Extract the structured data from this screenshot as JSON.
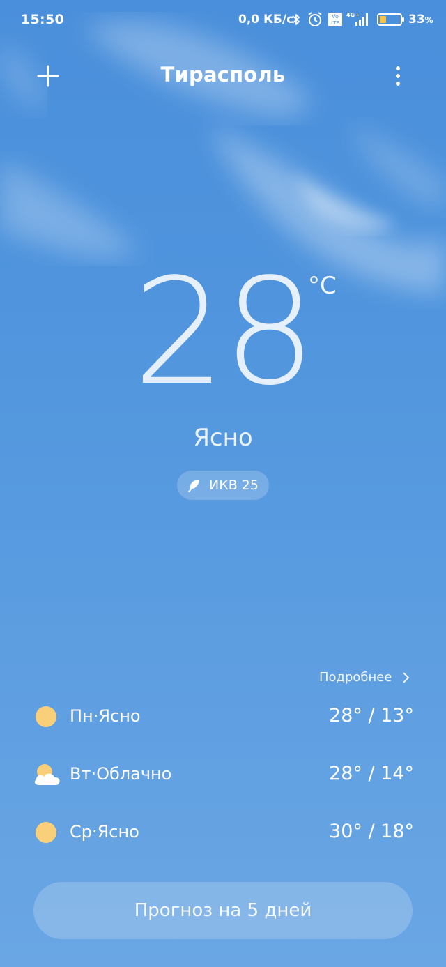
{
  "status_bar": {
    "time": "15:50",
    "network_speed": "0,0 КБ/с",
    "battery_percent": "33",
    "battery_unit": "%",
    "lte_badge_top": "Vo",
    "lte_badge_bottom": "LTE",
    "signal_badge": "4G+",
    "battery_level": 0.33,
    "icons": [
      "bluetooth-icon",
      "alarm-icon",
      "volte-icon",
      "signal-icon",
      "battery-icon"
    ]
  },
  "header": {
    "city": "Тирасполь",
    "add_icon": "plus-icon",
    "menu_icon": "more-vertical-icon"
  },
  "current": {
    "temperature": "28",
    "unit": "°C",
    "condition": "Ясно",
    "aqi_label": "ИКВ 25",
    "aqi_icon": "leaf-icon"
  },
  "forecast": {
    "more_label": "Подробнее",
    "days": [
      {
        "label": "Пн·Ясно",
        "temps": "28° / 13°",
        "icon": "sun-icon"
      },
      {
        "label": "Вт·Облачно",
        "temps": "28° / 14°",
        "icon": "partly-cloudy-icon"
      },
      {
        "label": "Ср·Ясно",
        "temps": "30° / 18°",
        "icon": "sun-icon"
      }
    ],
    "button_label": "Прогноз на 5 дней"
  },
  "colors": {
    "sky_top": "#4a8fdb",
    "sky_bottom": "#6aa6e4",
    "sun": "#f9cf79",
    "text": "#ffffff"
  }
}
